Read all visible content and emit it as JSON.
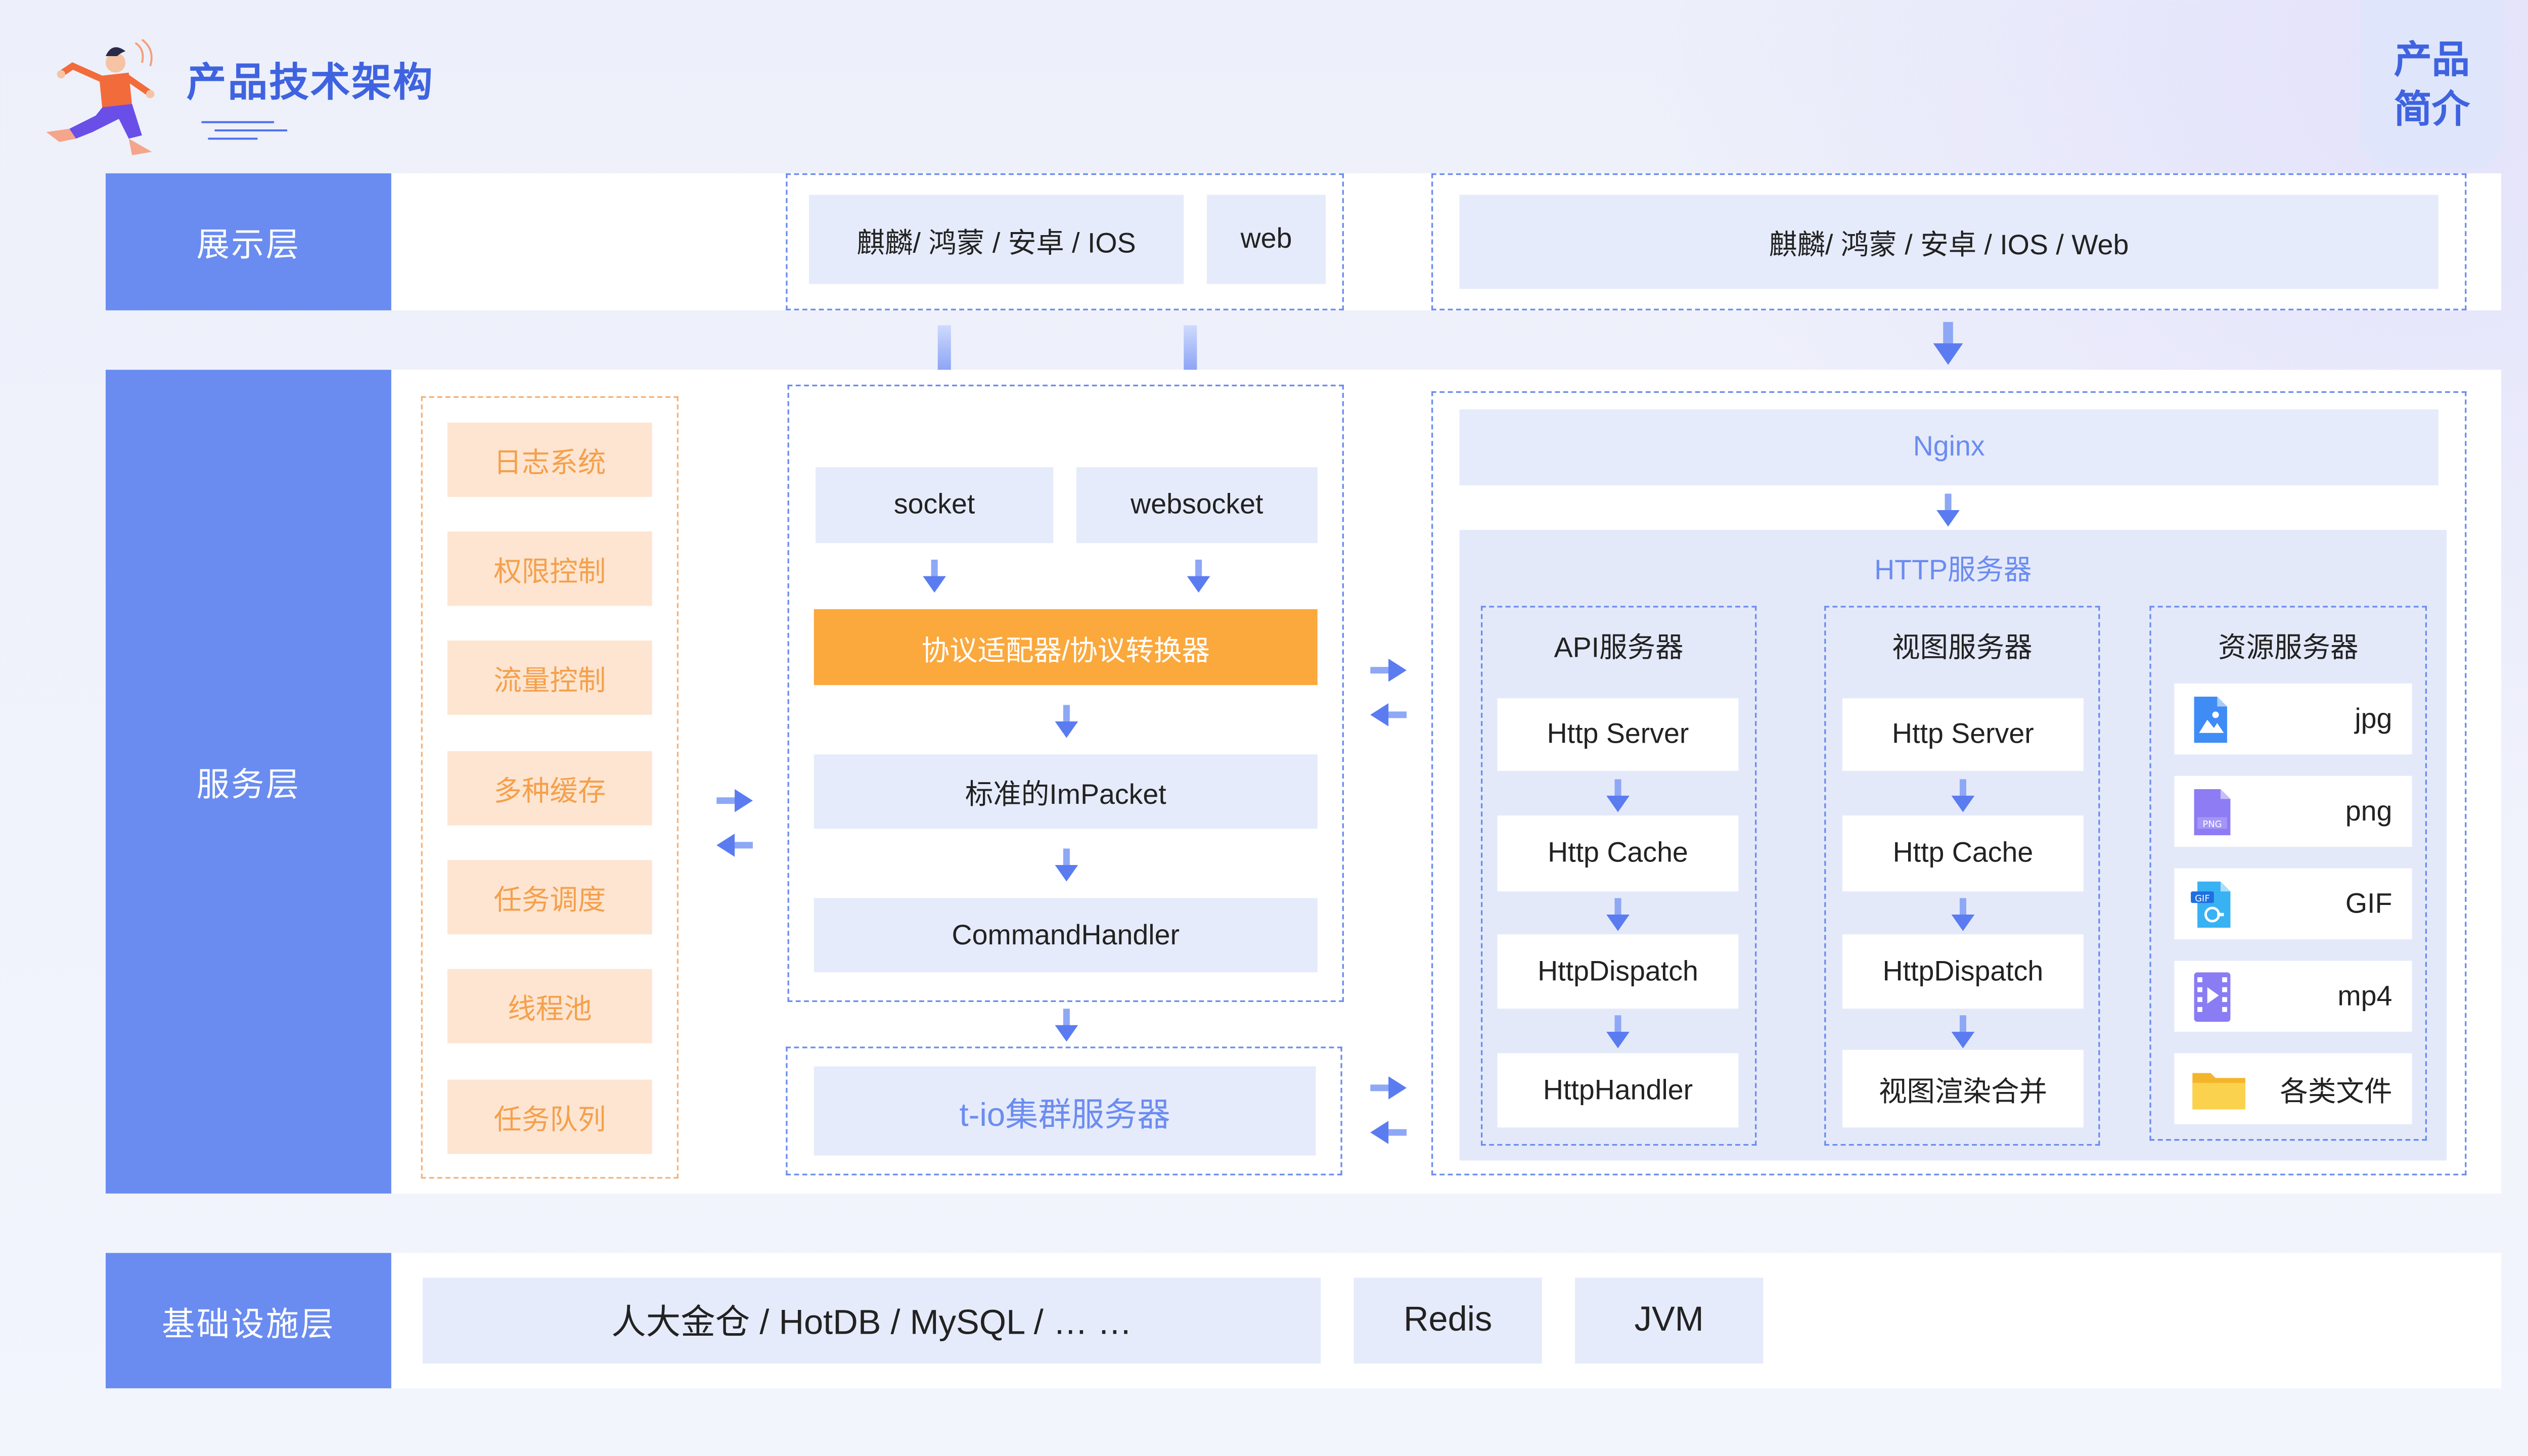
{
  "header": {
    "title": "产品技术架构",
    "tag_line1": "产品",
    "tag_line2": "简介"
  },
  "presentation": {
    "label": "展示层",
    "group_a": [
      "麒麟/ 鸿蒙 / 安卓 / IOS",
      "web"
    ],
    "group_b": "麒麟/ 鸿蒙 / 安卓 / IOS / Web"
  },
  "service": {
    "label": "服务层",
    "features": [
      "日志系统",
      "权限控制",
      "流量控制",
      "多种缓存",
      "任务调度",
      "线程池",
      "任务队列"
    ],
    "protocols": [
      "socket",
      "websocket"
    ],
    "adapter": "协议适配器/协议转换器",
    "packet": "标准的ImPacket",
    "handler": "CommandHandler",
    "cluster": "t-io集群服务器",
    "nginx": "Nginx",
    "http_server": "HTTP服务器",
    "api_server": {
      "title": "API服务器",
      "items": [
        "Http Server",
        "Http Cache",
        "HttpDispatch",
        "HttpHandler"
      ]
    },
    "view_server": {
      "title": "视图服务器",
      "items": [
        "Http Server",
        "Http Cache",
        "HttpDispatch",
        "视图渲染合并"
      ]
    },
    "resource_server": {
      "title": "资源服务器",
      "items": [
        {
          "label": "jpg",
          "icon": "jpg-file-icon"
        },
        {
          "label": "png",
          "icon": "png-file-icon"
        },
        {
          "label": "GIF",
          "icon": "gif-file-icon"
        },
        {
          "label": "mp4",
          "icon": "video-file-icon"
        },
        {
          "label": "各类文件",
          "icon": "folder-icon"
        }
      ]
    }
  },
  "infrastructure": {
    "label": "基础设施层",
    "items": [
      "人大金仓 / HotDB / MySQL / … …",
      "Redis",
      "JVM"
    ]
  },
  "colors": {
    "layer_label": "#6a8cf0",
    "box_fill": "#e6ebfb",
    "dash_border": "#6b8cf0",
    "feature_fill": "#fde5d2",
    "feature_text": "#f5a04b",
    "adapter_fill": "#fba83c",
    "title": "#3f63e0"
  }
}
